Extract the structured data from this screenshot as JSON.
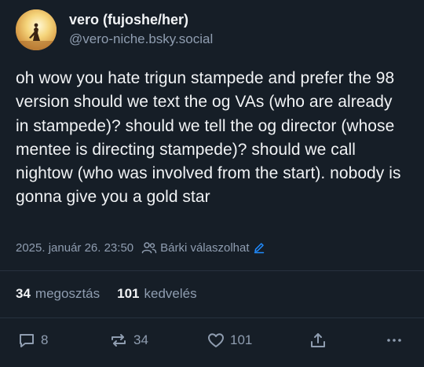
{
  "author": {
    "display_name": "vero (fujoshe/her)",
    "handle": "@vero-niche.bsky.social",
    "avatar_icon": "avatar-sunset-figure"
  },
  "post": {
    "text": "oh wow you hate trigun stampede and prefer the 98 version should we text the og VAs (who are already in stampede)? should we tell the og director (whose mentee is directing stampede)? should we call nightow (who was involved from the start). nobody is gonna give you a gold star",
    "timestamp": "2025. január 26. 23:50",
    "reply_setting": "Bárki válaszolhat"
  },
  "stats": {
    "reposts_count": "34",
    "reposts_label": "megosztás",
    "likes_count": "101",
    "likes_label": "kedvelés"
  },
  "actions": {
    "reply_count": "8",
    "repost_count": "34",
    "like_count": "101"
  },
  "colors": {
    "background": "#161e27",
    "text": "#f1f3f5",
    "muted": "#8f9db0",
    "accent": "#208bfe",
    "divider": "#27313e"
  }
}
